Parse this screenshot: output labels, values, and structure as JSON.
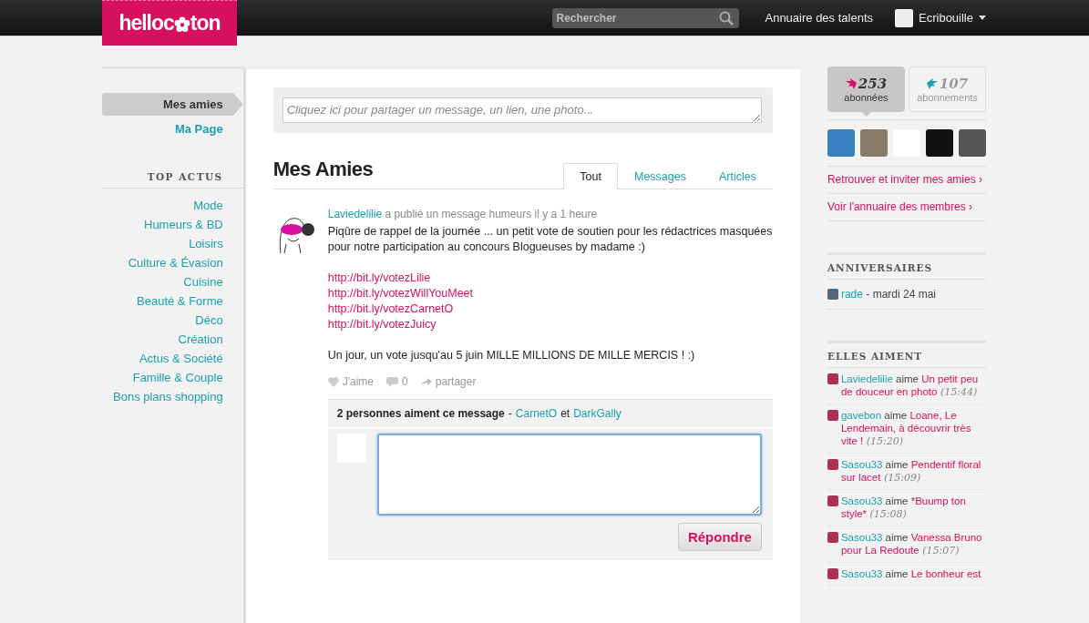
{
  "header": {
    "logo": [
      "helloc",
      "ton"
    ],
    "search": {
      "placeholder": "Rechercher"
    },
    "nav_link": "Annuaire des talents",
    "user": "Ecribouille"
  },
  "left_nav": {
    "items": [
      {
        "label": "Mes amies",
        "selected": true
      },
      {
        "label": "Ma Page",
        "selected": false
      }
    ],
    "section_title": "TOP ACTUS",
    "categories": [
      "Mode",
      "Humeurs & BD",
      "Loisirs",
      "Culture & Évasion",
      "Cuisine",
      "Beauté & Forme",
      "Déco",
      "Création",
      "Actus & Société",
      "Famille & Couple",
      "Bons plans shopping"
    ]
  },
  "share": {
    "placeholder": "Cliquez ici pour partager un message, un lien, une photo..."
  },
  "feed": {
    "title": "Mes Amies",
    "tabs": [
      {
        "label": "Tout",
        "selected": true
      },
      {
        "label": "Messages",
        "selected": false
      },
      {
        "label": "Articles",
        "selected": false
      }
    ],
    "post": {
      "author": "Laviedelilie",
      "meta": "a publié un message humeurs il y a 1 heure",
      "body": [
        {
          "kind": "text",
          "text": "Piqûre de rappel de la journée ... un petit vote de soutien pour les rédactrices masquées pour notre participation au concours Blogueuses by madame :)"
        },
        {
          "kind": "link",
          "text": "http://bit.ly/votezLilie"
        },
        {
          "kind": "link",
          "text": "http://bit.ly/votezWillYouMeet"
        },
        {
          "kind": "link",
          "text": "http://bit.ly/votezCarnetO"
        },
        {
          "kind": "link",
          "text": "http://bit.ly/votezJuicy"
        },
        {
          "kind": "text",
          "text": "Un jour, un vote jusqu'au 5 juin MILLE MILLIONS DE MILLE MERCIS ! :)"
        }
      ],
      "actions": {
        "like": "J'aime",
        "comments": "0",
        "share": "partager"
      },
      "likes": {
        "summary": "2 personnes aiment ce message",
        "separator": "-",
        "users": [
          "CarnetO",
          "DarkGally"
        ],
        "conjunction": "et"
      },
      "reply_button": "Répondre"
    }
  },
  "right": {
    "stats": [
      {
        "count": "253",
        "label": "abonnées",
        "selected": true,
        "color": "#d6105f"
      },
      {
        "count": "107",
        "label": "abonnements",
        "selected": false,
        "color": "#1a9fb0"
      }
    ],
    "links": [
      "Retrouver et inviter mes amies ›",
      "Voir l'annuaire des membres ›"
    ],
    "birthdays": {
      "title": "ANNIVERSAIRES",
      "items": [
        {
          "user": "rade",
          "rest": "- mardi 24 mai"
        }
      ]
    },
    "likes": {
      "title": "ELLES AIMENT",
      "items": [
        {
          "user": "Laviedelilie",
          "verb": "aime",
          "title": "Un petit peu de douceur en photo",
          "time": "(15:44)"
        },
        {
          "user": "gavebon",
          "verb": "aime",
          "title": "Loane, Le Lendemain, à découvrir très vite !",
          "time": "(15:20)"
        },
        {
          "user": "Sasou33",
          "verb": "aime",
          "title": "Pendentif floral sur lacet",
          "time": "(15:09)"
        },
        {
          "user": "Sasou33",
          "verb": "aime",
          "title": "*Buump ton style*",
          "time": "(15:08)"
        },
        {
          "user": "Sasou33",
          "verb": "aime",
          "title": "Vanessa Bruno pour La Redoute",
          "time": "(15:07)"
        },
        {
          "user": "Sasou33",
          "verb": "aime",
          "title": "Le bonheur est"
        }
      ]
    }
  }
}
